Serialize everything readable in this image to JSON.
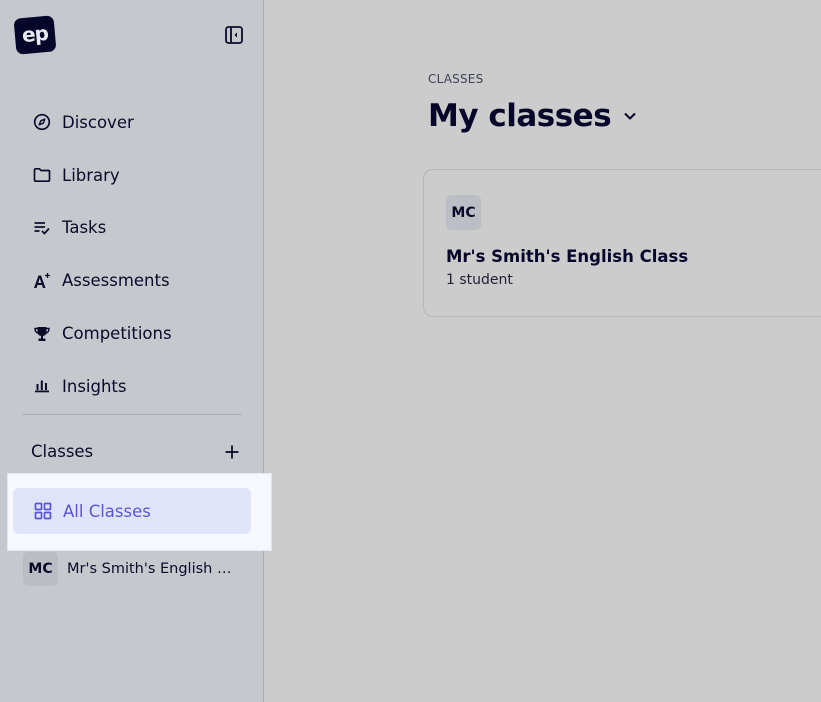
{
  "app": {
    "logo_text": "ep"
  },
  "sidebar": {
    "collapse_icon": "sidebar-collapse-icon",
    "nav_items": [
      {
        "label": "Discover",
        "icon": "compass-icon"
      },
      {
        "label": "Library",
        "icon": "folder-icon"
      },
      {
        "label": "Tasks",
        "icon": "tasks-icon"
      },
      {
        "label": "Assessments",
        "icon": "assessment-icon"
      },
      {
        "label": "Competitions",
        "icon": "trophy-icon"
      },
      {
        "label": "Insights",
        "icon": "bar-chart-icon"
      }
    ],
    "classes_section": {
      "title": "Classes",
      "add_icon": "plus-icon",
      "all_classes_label": "All Classes",
      "all_classes_icon": "grid-icon",
      "classes": [
        {
          "initials": "MC",
          "name": "Mr's Smith's English Class"
        }
      ]
    },
    "colors": {
      "active_bg": "#e0e4fb",
      "active_text": "#5b55d6"
    }
  },
  "main": {
    "eyebrow": "CLASSES",
    "title": "My classes",
    "cards": [
      {
        "initials": "MC",
        "name": "Mr's Smith's English Class",
        "meta": "1 student"
      }
    ]
  }
}
